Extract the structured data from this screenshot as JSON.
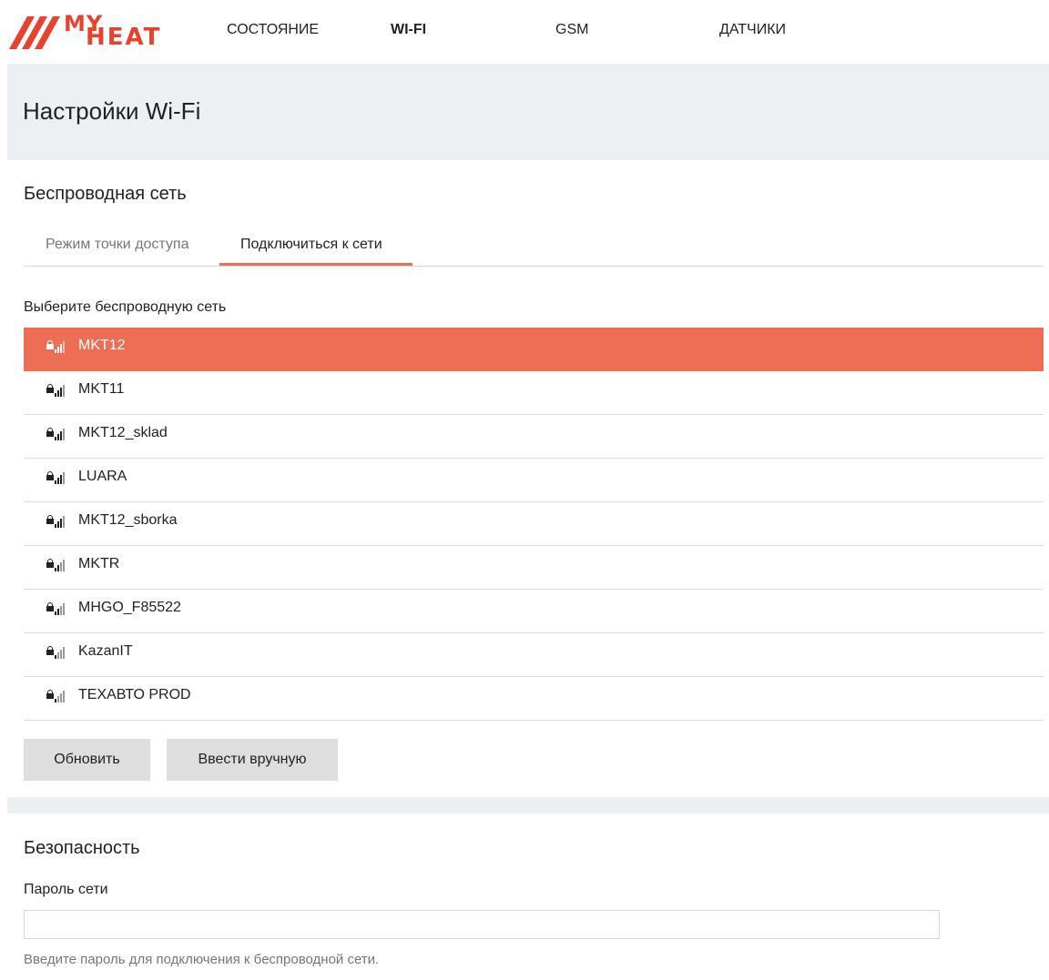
{
  "colors": {
    "accent": "#ec6e55",
    "brand": "#e8412e",
    "header_bg": "#edf0f3"
  },
  "nav": {
    "logo_my": "MY",
    "logo_heat": "HEAT",
    "items": [
      "СОСТОЯНИЕ",
      "WI-FI",
      "GSM",
      "ДАТЧИКИ"
    ],
    "active": "WI-FI"
  },
  "page": {
    "title": "Настройки Wi-Fi"
  },
  "wireless": {
    "title": "Беспроводная сеть",
    "tabs": [
      "Режим точки доступа",
      "Подключиться к сети"
    ],
    "active_tab": "Подключиться к сети",
    "list_label": "Выберите беспроводную сеть",
    "networks": [
      {
        "name": "MKT12",
        "icon": "wifi-signal-lock-icon",
        "selected": true
      },
      {
        "name": "MKT11",
        "icon": "wifi-signal-lock-icon"
      },
      {
        "name": "MKT12_sklad",
        "icon": "wifi-signal-lock-icon"
      },
      {
        "name": "LUARA",
        "icon": "wifi-signal-lock-icon"
      },
      {
        "name": "MKT12_sborka",
        "icon": "wifi-signal-lock-icon"
      },
      {
        "name": "MKTR",
        "icon": "wifi-signal-lock-icon"
      },
      {
        "name": "MHGO_F85522",
        "icon": "wifi-signal-lock-icon"
      },
      {
        "name": "KazanIT",
        "icon": "wifi-signal-lock-icon"
      },
      {
        "name": "ТЕХАВТО PROD",
        "icon": "wifi-signal-lock-icon"
      }
    ],
    "refresh_label": "Обновить",
    "manual_label": "Ввести вручную"
  },
  "security": {
    "title": "Безопасность",
    "password_label": "Пароль сети",
    "password_value": "",
    "hint": "Введите пароль для подключения к беспроводной сети."
  }
}
